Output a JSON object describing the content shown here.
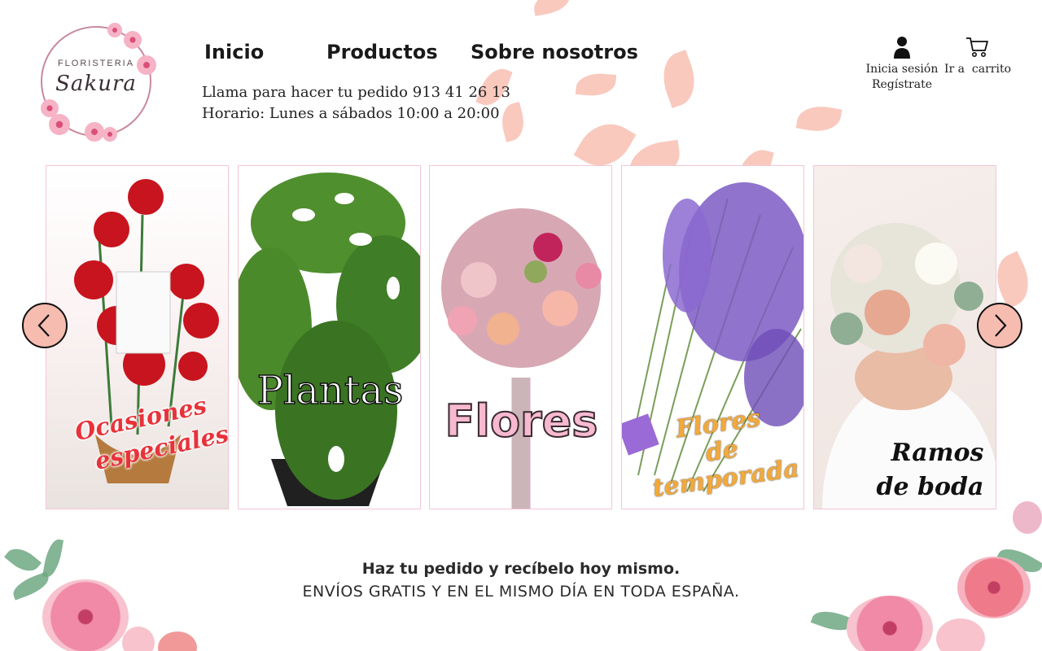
{
  "logo": {
    "top_text": "FLORISTERIA",
    "script_text": "Sakura"
  },
  "nav": {
    "items": [
      "Inicio",
      "Productos",
      "Sobre nosotros"
    ]
  },
  "contact": {
    "phone_line": "Llama para hacer tu pedido 913 41 26 13",
    "hours_line": "Horario: Lunes a sábados 10:00 a 20:00"
  },
  "account": {
    "login_label": "Inicia sesión",
    "register_label": "Regístrate",
    "icon": "user-icon"
  },
  "cart": {
    "label": "Ir a  carrito",
    "icon": "cart-icon"
  },
  "carousel": {
    "prev_icon": "chevron-left-icon",
    "next_icon": "chevron-right-icon",
    "cards": [
      {
        "title_line1": "Ocasiones",
        "title_line2": "especiales"
      },
      {
        "title_line1": "Plantas"
      },
      {
        "title_line1": "Flores"
      },
      {
        "title_line1": "Flores",
        "title_line2": "de",
        "title_line3": "temporada"
      },
      {
        "title_line1": "Ramos",
        "title_line2": "de boda"
      }
    ]
  },
  "promo": {
    "headline": "Haz tu pedido y recíbelo hoy mismo.",
    "subline": "ENVÍOS GRATIS Y EN EL MISMO DÍA EN TODA ESPAÑA."
  },
  "colors": {
    "accent": "#f6bcb0",
    "petal": "#f7b7a8",
    "card_border": "#f2c6d2"
  }
}
